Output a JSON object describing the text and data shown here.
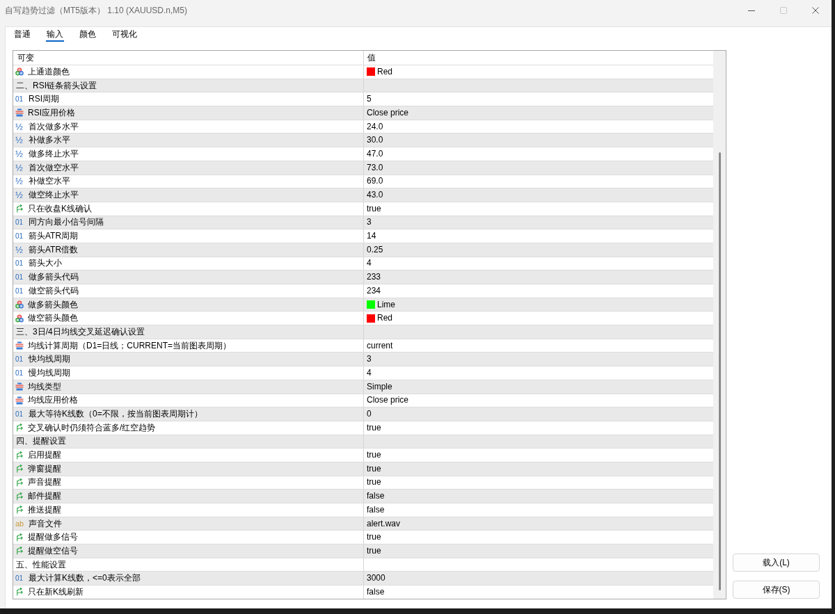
{
  "window": {
    "title": "自写趋势过滤（MT5版本） 1.10 (XAUUSD.n,M5)",
    "maximize_disabled": true
  },
  "tabs": [
    {
      "label": "普通",
      "selected": false
    },
    {
      "label": "输入",
      "selected": true
    },
    {
      "label": "颜色",
      "selected": false
    },
    {
      "label": "可视化",
      "selected": false
    }
  ],
  "table": {
    "columns": [
      "可变",
      "值"
    ],
    "rows": [
      {
        "kind": "color",
        "name": "上通道颜色",
        "value": "Red",
        "color": "#ff0000"
      },
      {
        "kind": "section",
        "name": "二、RSI链条箭头设置"
      },
      {
        "kind": "int",
        "type_mark": "01",
        "name": "RSI周期",
        "value": "5"
      },
      {
        "kind": "enum",
        "name": "RSI应用价格",
        "value": "Close price"
      },
      {
        "kind": "double",
        "type_mark": "½",
        "name": "首次做多水平",
        "value": "24.0"
      },
      {
        "kind": "double",
        "type_mark": "½",
        "name": "补做多水平",
        "value": "30.0"
      },
      {
        "kind": "double",
        "type_mark": "½",
        "name": "做多终止水平",
        "value": "47.0"
      },
      {
        "kind": "double",
        "type_mark": "½",
        "name": "首次做空水平",
        "value": "73.0"
      },
      {
        "kind": "double",
        "type_mark": "½",
        "name": "补做空水平",
        "value": "69.0"
      },
      {
        "kind": "double",
        "type_mark": "½",
        "name": "做空终止水平",
        "value": "43.0"
      },
      {
        "kind": "bool",
        "name": "只在收盘K线确认",
        "value": "true"
      },
      {
        "kind": "int",
        "type_mark": "01",
        "name": "同方向最小信号间隔",
        "value": "3"
      },
      {
        "kind": "int",
        "type_mark": "01",
        "name": "箭头ATR周期",
        "value": "14"
      },
      {
        "kind": "double",
        "type_mark": "½",
        "name": "箭头ATR倍数",
        "value": "0.25"
      },
      {
        "kind": "int",
        "type_mark": "01",
        "name": "箭头大小",
        "value": "4"
      },
      {
        "kind": "int",
        "type_mark": "01",
        "name": "做多箭头代码",
        "value": "233"
      },
      {
        "kind": "int",
        "type_mark": "01",
        "name": "做空箭头代码",
        "value": "234"
      },
      {
        "kind": "color",
        "name": "做多箭头颜色",
        "value": "Lime",
        "color": "#00ff00"
      },
      {
        "kind": "color",
        "name": "做空箭头颜色",
        "value": "Red",
        "color": "#ff0000"
      },
      {
        "kind": "section",
        "name": "三、3日/4日均线交叉延迟确认设置"
      },
      {
        "kind": "enum",
        "name": "均线计算周期（D1=日线；CURRENT=当前图表周期）",
        "value": "current"
      },
      {
        "kind": "int",
        "type_mark": "01",
        "name": "快均线周期",
        "value": "3"
      },
      {
        "kind": "int",
        "type_mark": "01",
        "name": "慢均线周期",
        "value": "4"
      },
      {
        "kind": "enum",
        "name": "均线类型",
        "value": "Simple"
      },
      {
        "kind": "enum",
        "name": "均线应用价格",
        "value": "Close price"
      },
      {
        "kind": "int",
        "type_mark": "01",
        "name": "最大等待K线数（0=不限，按当前图表周期计）",
        "value": "0"
      },
      {
        "kind": "bool",
        "name": "交叉确认时仍须符合蓝多/红空趋势",
        "value": "true"
      },
      {
        "kind": "section",
        "name": "四、提醒设置"
      },
      {
        "kind": "bool",
        "name": "启用提醒",
        "value": "true"
      },
      {
        "kind": "bool",
        "name": "弹窗提醒",
        "value": "true"
      },
      {
        "kind": "bool",
        "name": "声音提醒",
        "value": "true"
      },
      {
        "kind": "bool",
        "name": "邮件提醒",
        "value": "false"
      },
      {
        "kind": "bool",
        "name": "推送提醒",
        "value": "false"
      },
      {
        "kind": "string",
        "type_mark": "ab",
        "name": "声音文件",
        "value": "alert.wav"
      },
      {
        "kind": "bool",
        "name": "提醒做多信号",
        "value": "true"
      },
      {
        "kind": "bool",
        "name": "提醒做空信号",
        "value": "true"
      },
      {
        "kind": "section",
        "name": "五、性能设置"
      },
      {
        "kind": "int",
        "type_mark": "01",
        "name": "最大计算K线数，<=0表示全部",
        "value": "3000"
      },
      {
        "kind": "bool",
        "name": "只在新K线刷新",
        "value": "false"
      }
    ]
  },
  "buttons": [
    {
      "label": "载入(L)"
    },
    {
      "label": "保存(S)"
    }
  ]
}
